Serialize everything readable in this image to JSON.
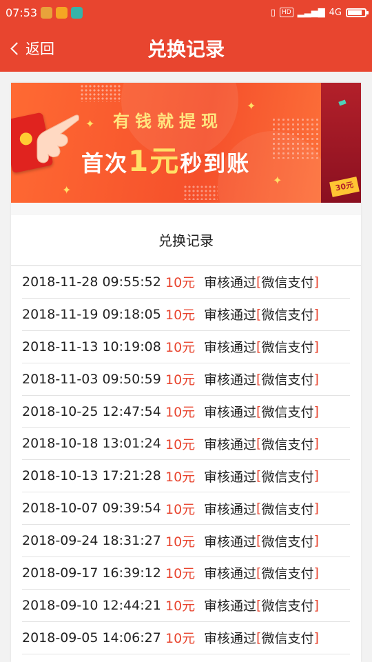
{
  "status_bar": {
    "time": "07:53",
    "network_badge": "HD",
    "network_type": "4G",
    "signal_label": "4G"
  },
  "header": {
    "back_label": "返回",
    "title": "兑换记录"
  },
  "banner": {
    "line1": "有钱就提现",
    "line2_prefix": "首次",
    "line2_amount": "1元",
    "line2_suffix": "秒到账",
    "side_tag": "30元"
  },
  "section": {
    "title": "兑换记录"
  },
  "records": [
    {
      "datetime": "2018-11-28 09:55:52",
      "amount": "10元",
      "status": "审核通过",
      "method": "微信支付"
    },
    {
      "datetime": "2018-11-19 09:18:05",
      "amount": "10元",
      "status": "审核通过",
      "method": "微信支付"
    },
    {
      "datetime": "2018-11-13 10:19:08",
      "amount": "10元",
      "status": "审核通过",
      "method": "微信支付"
    },
    {
      "datetime": "2018-11-03 09:50:59",
      "amount": "10元",
      "status": "审核通过",
      "method": "微信支付"
    },
    {
      "datetime": "2018-10-25 12:47:54",
      "amount": "10元",
      "status": "审核通过",
      "method": "微信支付"
    },
    {
      "datetime": "2018-10-18 13:01:24",
      "amount": "10元",
      "status": "审核通过",
      "method": "微信支付"
    },
    {
      "datetime": "2018-10-13 17:21:28",
      "amount": "10元",
      "status": "审核通过",
      "method": "微信支付"
    },
    {
      "datetime": "2018-10-07 09:39:54",
      "amount": "10元",
      "status": "审核通过",
      "method": "微信支付"
    },
    {
      "datetime": "2018-09-24 18:31:27",
      "amount": "10元",
      "status": "审核通过",
      "method": "微信支付"
    },
    {
      "datetime": "2018-09-17 16:39:12",
      "amount": "10元",
      "status": "审核通过",
      "method": "微信支付"
    },
    {
      "datetime": "2018-09-10 12:44:21",
      "amount": "10元",
      "status": "审核通过",
      "method": "微信支付"
    },
    {
      "datetime": "2018-09-05 14:06:27",
      "amount": "10元",
      "status": "审核通过",
      "method": "微信支付"
    }
  ],
  "colors": {
    "accent": "#e8452f",
    "banner_yellow": "#ffe066"
  }
}
